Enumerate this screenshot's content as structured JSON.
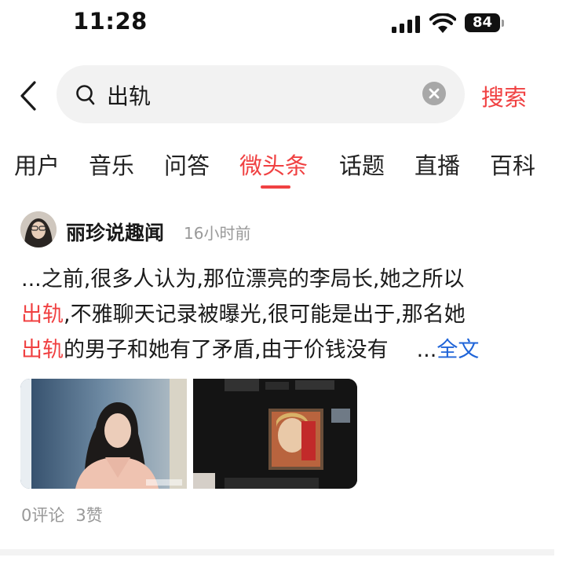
{
  "status_bar": {
    "time": "11:28",
    "battery": "84"
  },
  "search": {
    "query": "出轨",
    "button_label": "搜索"
  },
  "tabs": [
    {
      "label": "用户"
    },
    {
      "label": "音乐"
    },
    {
      "label": "问答"
    },
    {
      "label": "微头条",
      "active": true
    },
    {
      "label": "话题"
    },
    {
      "label": "直播"
    },
    {
      "label": "百科"
    }
  ],
  "post": {
    "author": "丽珍说趣闻",
    "time": "16小时前",
    "text_lines": [
      [
        "...之前,很多人认为,那位漂亮的李局长,她之所以"
      ],
      [
        "出轨",
        ",不雅聊天记录被曝光,很可能是出于,那名她"
      ],
      [
        "出轨",
        "的男子和她有了矛盾,由于价钱没有"
      ]
    ],
    "ellipsis": "...",
    "more_label": "全文",
    "comments": "0评论",
    "likes": "3赞"
  },
  "colors": {
    "accent": "#f04142",
    "link": "#1f64d8",
    "muted": "#999999"
  }
}
